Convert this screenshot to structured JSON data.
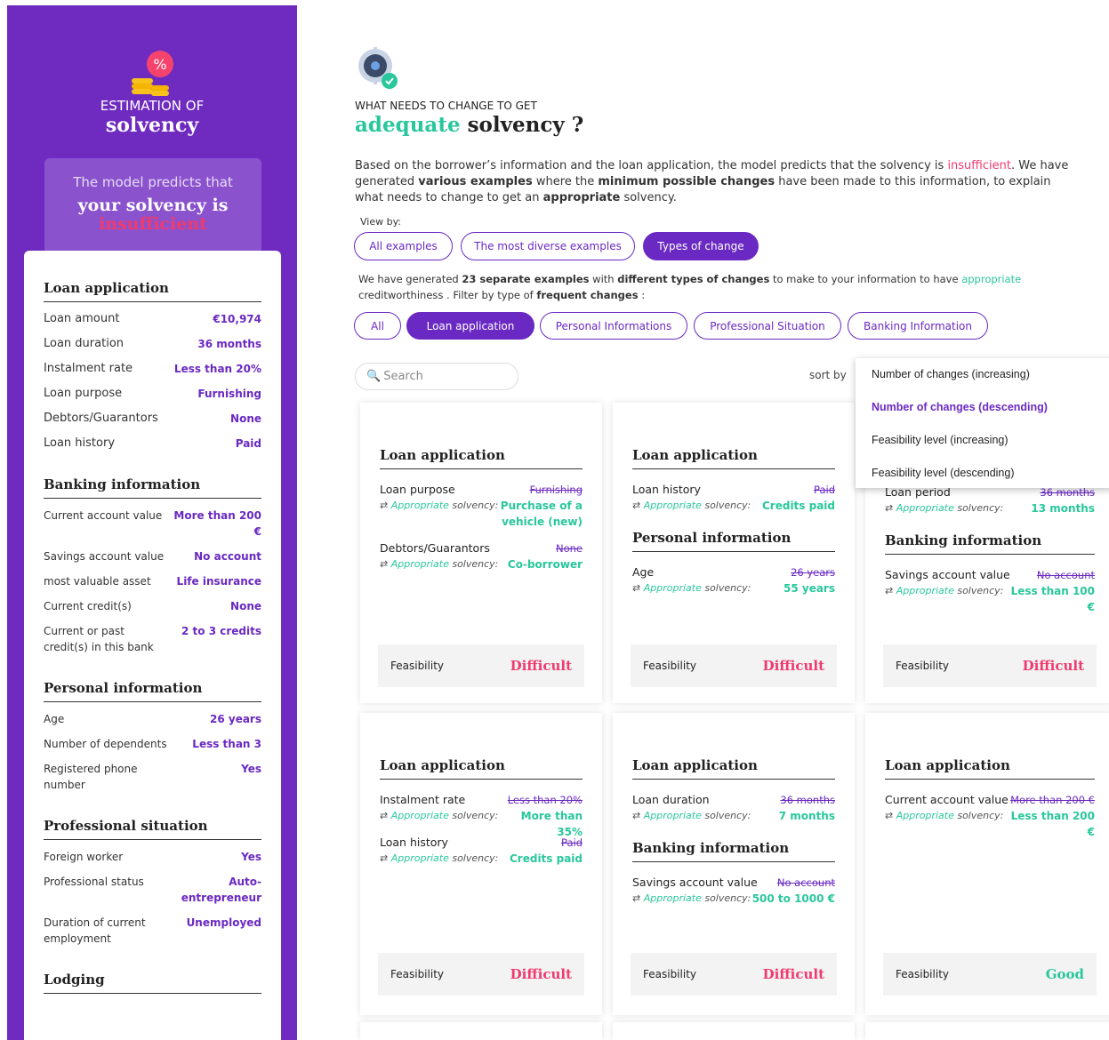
{
  "sidebar": {
    "est_line1": "ESTIMATION OF",
    "est_line2": "solvency",
    "predict_l1": "The model predicts that",
    "predict_l2": "your solvency is",
    "predict_l3": "insufficient",
    "sections": [
      {
        "title": "Loan application",
        "rows": [
          [
            "Loan amount",
            "€10,974"
          ],
          [
            "Loan duration",
            "36 months"
          ],
          [
            "Instalment rate",
            "Less than 20%"
          ],
          [
            "Loan purpose",
            "Furnishing"
          ],
          [
            "Debtors/Guarantors",
            "None"
          ],
          [
            "Loan history",
            "Paid"
          ]
        ]
      },
      {
        "title": "Banking information",
        "rows": [
          [
            "Current account value",
            "More than 200 €"
          ],
          [
            "Savings account value",
            "No account"
          ],
          [
            "most valuable asset",
            "Life insurance"
          ],
          [
            "Current credit(s)",
            "None"
          ],
          [
            "Current or past credit(s) in this bank",
            "2 to 3 credits"
          ]
        ]
      },
      {
        "title": "Personal information",
        "rows": [
          [
            "Age",
            "26 years"
          ],
          [
            "Number of dependents",
            "Less than 3"
          ],
          [
            "Registered phone number",
            "Yes"
          ]
        ]
      },
      {
        "title": "Professional situation",
        "rows": [
          [
            "Foreign worker",
            "Yes"
          ],
          [
            "Professional status",
            "Auto-entrepreneur"
          ],
          [
            "Duration of current employment",
            "Unemployed"
          ]
        ]
      },
      {
        "title": "Lodging",
        "rows": []
      }
    ]
  },
  "main": {
    "subtitle": "WHAT NEEDS TO CHANGE TO GET",
    "title_green": "adequate",
    "title_rest": " solvency ?",
    "desc": {
      "a": "Based on the borrower’s information and the loan application, the model predicts that the solvency is ",
      "b": "insufficient",
      "c": ". We have generated ",
      "d": "various examples",
      "e": " where the ",
      "f": "minimum possible changes",
      "g": " have been made to this information, to explain what needs to change to get an ",
      "h": "appropriate",
      "i": " solvency."
    },
    "view_by": "View by:",
    "view_tabs": [
      "All examples",
      "The most diverse examples",
      "Types of change"
    ],
    "gen": {
      "a": "We have generated ",
      "b": "23 separate examples",
      "c": " with ",
      "d": "different types of changes",
      "e": " to make to your information to have ",
      "f": "appropriate",
      "g": " creditworthiness . Filter by type of ",
      "h": "frequent changes",
      "i": " :"
    },
    "filters": [
      "All",
      "Loan application",
      "Personal Informations",
      "Professional Situation",
      "Banking Information"
    ],
    "search_placeholder": "Search",
    "sort_by": "sort by",
    "sort_options": [
      "Number of changes (increasing)",
      "Number of changes (descending)",
      "Feasibility level (increasing)",
      "Feasibility level (descending)"
    ],
    "appropriate": "Appropriate",
    "solvency": " solvency:",
    "feasibility": "Feasibility",
    "cards": [
      {
        "feas": "Difficult",
        "groups": [
          {
            "title": "Loan application",
            "attrs": [
              {
                "name": "Loan purpose",
                "old": "Furnishing",
                "new": "Purchase of a vehicle (new)"
              },
              {
                "name": "Debtors/Guarantors",
                "old": "None",
                "new": "Co-borrower"
              }
            ]
          }
        ]
      },
      {
        "feas": "Difficult",
        "groups": [
          {
            "title": "Loan application",
            "attrs": [
              {
                "name": "Loan history",
                "old": "Paid",
                "new": "Credits paid"
              }
            ]
          },
          {
            "title": "Personal information",
            "attrs": [
              {
                "name": "Age",
                "old": "26 years",
                "new": "55 years"
              }
            ]
          }
        ]
      },
      {
        "feas": "Difficult",
        "groups": [
          {
            "title": "",
            "attrs": [
              {
                "name": "Loan period",
                "old": "36 months",
                "new": "13 months"
              }
            ]
          },
          {
            "title": "Banking information",
            "attrs": [
              {
                "name": "Savings account value",
                "old": "No account",
                "new": "Less than 100 €"
              }
            ]
          }
        ]
      },
      {
        "feas": "Difficult",
        "groups": [
          {
            "title": "Loan application",
            "attrs": [
              {
                "name": "Instalment rate",
                "old": "Less than 20%",
                "new": "More than 35%"
              },
              {
                "name": "Loan history",
                "old": "Paid",
                "new": "Credits paid"
              }
            ]
          }
        ]
      },
      {
        "feas": "Difficult",
        "groups": [
          {
            "title": "Loan application",
            "attrs": [
              {
                "name": "Loan duration",
                "old": "36 months",
                "new": "7 months"
              }
            ]
          },
          {
            "title": "Banking information",
            "attrs": [
              {
                "name": "Savings account value",
                "old": "No account",
                "new": "500 to 1000 €"
              }
            ]
          }
        ]
      },
      {
        "feas": "Good",
        "groups": [
          {
            "title": "Loan application",
            "attrs": [
              {
                "name": "Current account value",
                "old": "More than 200 €",
                "new": "Less than 200 €"
              }
            ]
          }
        ]
      }
    ]
  },
  "colors": {
    "purple": "#6f2bc0",
    "green": "#29c79c",
    "pink": "#f03a6e"
  }
}
